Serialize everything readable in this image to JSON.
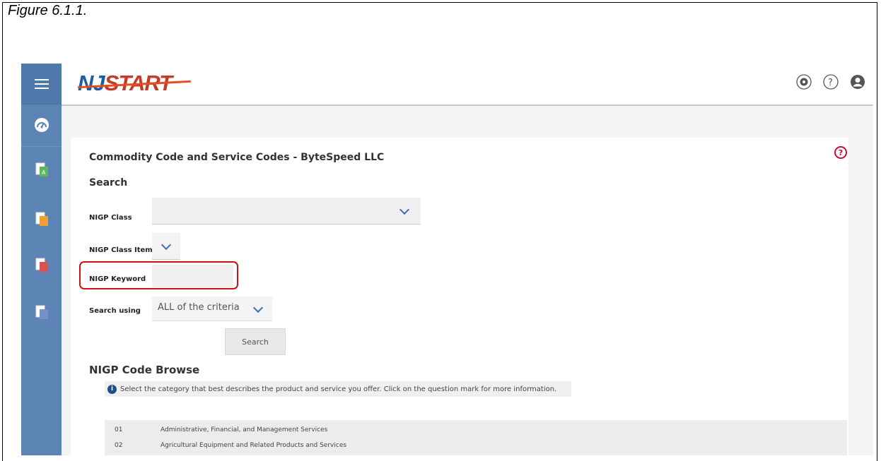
{
  "figure_caption": "Figure 6.1.1.",
  "header": {
    "logo_nj": "NJ",
    "logo_start": "START",
    "icons": [
      "gear-icon",
      "help-icon",
      "user-icon"
    ]
  },
  "sidebar": {
    "icons": [
      "menu-icon",
      "dashboard-icon",
      "document-green-icon",
      "document-orange-icon",
      "document-red-icon",
      "document-blue-icon"
    ]
  },
  "page": {
    "title": "Commodity Code and Service Codes - ByteSpeed LLC",
    "help": "?",
    "search_section": "Search",
    "fields": {
      "nigp_class_label": "NIGP Class",
      "nigp_class_value": "",
      "nigp_class_item_label": "NIGP Class Item",
      "nigp_class_item_value": "",
      "nigp_keyword_label": "NIGP Keyword",
      "nigp_keyword_value": "",
      "search_using_label": "Search using",
      "search_using_value": "ALL of the criteria"
    },
    "search_button": "Search",
    "browse_title": "NIGP Code Browse",
    "info_icon": "i",
    "info_text": "Select the category that best describes the product and service you offer. Click on the question mark for more information.",
    "codes": [
      {
        "code": "01",
        "description": "Administrative, Financial, and Management Services"
      },
      {
        "code": "02",
        "description": "Agricultural Equipment and Related Products and Services"
      }
    ]
  },
  "colors": {
    "sidebar": "#5c85b5",
    "accent_blue": "#3b73b9",
    "highlight_red": "#d01010"
  }
}
